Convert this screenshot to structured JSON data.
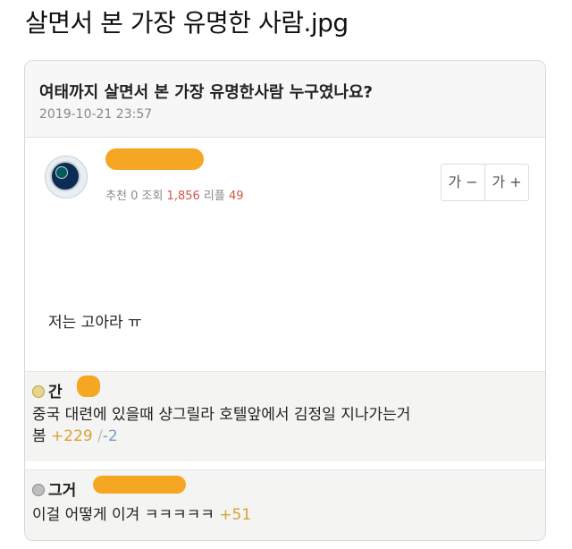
{
  "page": {
    "title": "살면서 본 가장 유명한 사람.jpg"
  },
  "post": {
    "title": "여태까지 살면서 본 가장 유명한사람 누구였나요?",
    "date": "2019-10-21 23:57",
    "stats": {
      "recommend_label": "추천",
      "recommend_value": "0",
      "views_label": "조회",
      "views_value": "1,856",
      "replies_label": "리플",
      "replies_value": "49"
    },
    "font_controls": {
      "decrease": "가 −",
      "increase": "가 +"
    },
    "body": "저는 고아라 ㅠ"
  },
  "comments": [
    {
      "name": "간",
      "text": "중국 대련에 있을때 샹그릴라 호텔앞에서 김정일 지나가는거",
      "text2": "봄",
      "up": "+229",
      "sep": "/",
      "down": "-2"
    },
    {
      "name": "그거",
      "text": "이걸 어떻게 이겨 ㅋㅋㅋㅋㅋ",
      "up": "+51"
    }
  ],
  "colors": {
    "redaction": "#f5a623",
    "upvote": "#d8a23a",
    "downvote": "#7a9cc6",
    "stat_number": "#d0564a"
  },
  "icons": {
    "avatar": "team-logo-avatar",
    "medal_gold": "gold-medal-icon",
    "medal_gray": "gray-medal-icon"
  }
}
